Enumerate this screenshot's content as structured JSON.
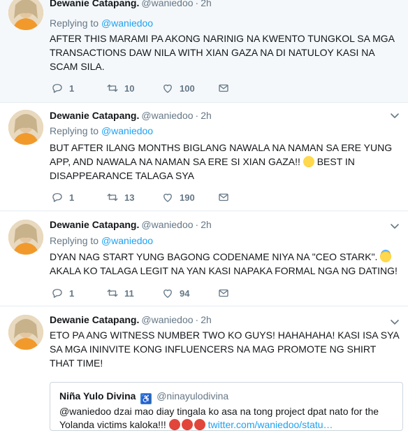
{
  "tweets": [
    {
      "name": "Dewanie Catapang.",
      "handle": "@waniedoo",
      "time": "2h",
      "replying_label": "Replying to",
      "replying_to": "@waniedoo",
      "text": "AFTER THIS MARAMI PA AKONG NARINIG NA KWENTO TUNGKOL SA MGA TRANSACTIONS DAW NILA WITH XIAN GAZA NA DI NATULOY KASI NA SCAM SILA.",
      "replies": "1",
      "retweets": "10",
      "likes": "100"
    },
    {
      "name": "Dewanie Catapang.",
      "handle": "@waniedoo",
      "time": "2h",
      "replying_label": "Replying to",
      "replying_to": "@waniedoo",
      "text": "BUT AFTER ILANG MONTHS BIGLANG NAWALA NA NAMAN SA ERE YUNG APP, AND NAWALA NA NAMAN SA ERE SI XIAN GAZA!!",
      "text_after_emoji": " BEST IN DISAPPEARANCE TALAGA SYA",
      "replies": "1",
      "retweets": "13",
      "likes": "190"
    },
    {
      "name": "Dewanie Catapang.",
      "handle": "@waniedoo",
      "time": "2h",
      "replying_label": "Replying to",
      "replying_to": "@waniedoo",
      "text": "DYAN NAG START YUNG BAGONG CODENAME NIYA NA \"CEO STARK\".",
      "text_after_emoji": " AKALA KO TALAGA LEGIT NA YAN KASI NAPAKA FORMAL NGA NG DATING!",
      "replies": "1",
      "retweets": "11",
      "likes": "94"
    },
    {
      "name": "Dewanie Catapang.",
      "handle": "@waniedoo",
      "time": "2h",
      "text": "ETO PA ANG WITNESS NUMBER TWO KO GUYS! HAHAHAHA! KASI ISA SYA SA MGA ININVITE KONG INFLUENCERS NA MAG PROMOTE NG SHIRT THAT TIME!",
      "quote": {
        "name": "Niña Yulo Divina",
        "handle": "@ninayulodivina",
        "text": "@waniedoo dzai mao diay tingala ko asa na tong project dpat nato for the Yolanda victims kaloka!!!",
        "link": "twitter.com/waniedoo/statu…"
      }
    }
  ],
  "colors": {
    "accent": "#1da1f2",
    "secondary_text": "#657786",
    "border": "#e6ecf0"
  },
  "icons": [
    "reply-icon",
    "retweet-icon",
    "like-icon",
    "dm-icon",
    "chevron-down-icon",
    "accessibility-icon",
    "angry-face-emoji",
    "grinning-sweat-emoji",
    "halo-smile-emoji"
  ]
}
